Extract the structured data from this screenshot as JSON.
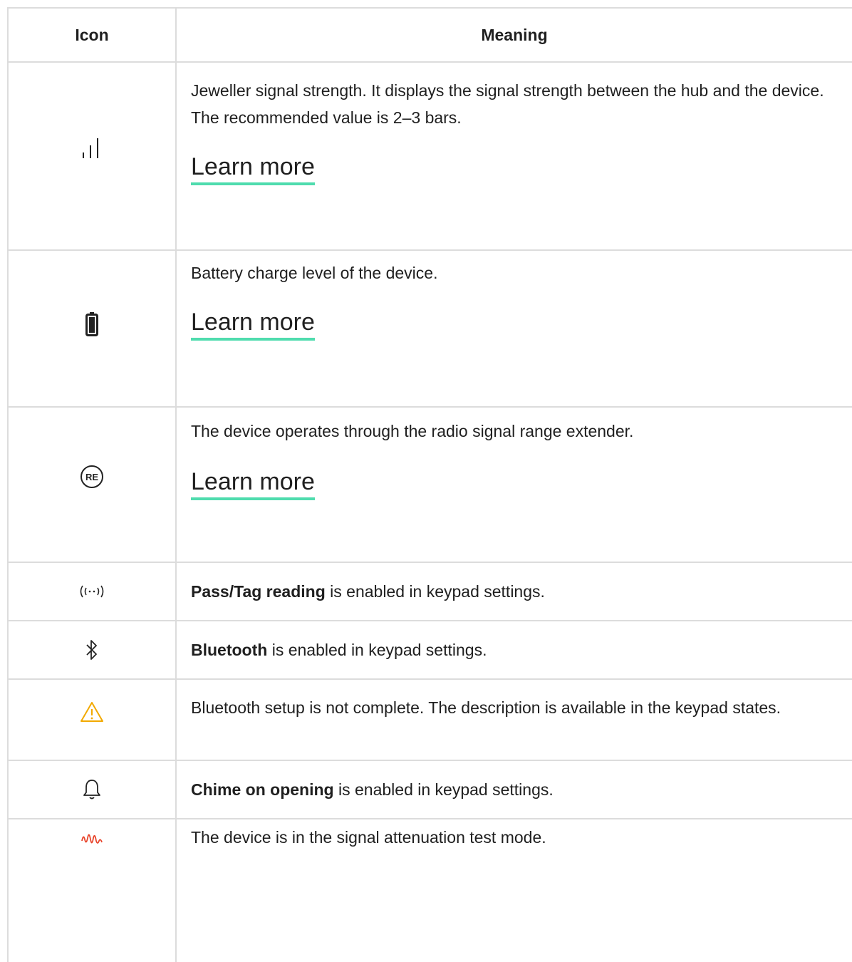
{
  "header": {
    "icon_col": "Icon",
    "meaning_col": "Meaning"
  },
  "rows": [
    {
      "icon": "signal-strength-icon",
      "text": "Jeweller signal strength. It displays the signal strength between the hub and the device. The recommended value is 2–3 bars.",
      "link": "Learn more"
    },
    {
      "icon": "battery-icon",
      "text": "Battery charge level of the device.",
      "link": "Learn more"
    },
    {
      "icon": "range-extender-icon",
      "icon_text": "RE",
      "text": "The device operates through the radio signal range extender.",
      "link": "Learn more"
    },
    {
      "icon": "pass-tag-reading-icon",
      "bold": "Pass/Tag reading",
      "text": " is enabled in keypad settings."
    },
    {
      "icon": "bluetooth-icon",
      "bold": "Bluetooth",
      "text": " is enabled in keypad settings."
    },
    {
      "icon": "warning-icon",
      "text": "Bluetooth setup is not complete. The description is available in the keypad states."
    },
    {
      "icon": "bell-icon",
      "bold": "Chime on opening",
      "text": " is enabled in keypad settings."
    },
    {
      "icon": "attenuation-test-icon",
      "text": "The device is in the signal attenuation test mode."
    }
  ],
  "colors": {
    "link_underline": "#4fdcae",
    "warning": "#f2a900",
    "attenuation": "#e8452c",
    "border": "#dcdcdc"
  }
}
